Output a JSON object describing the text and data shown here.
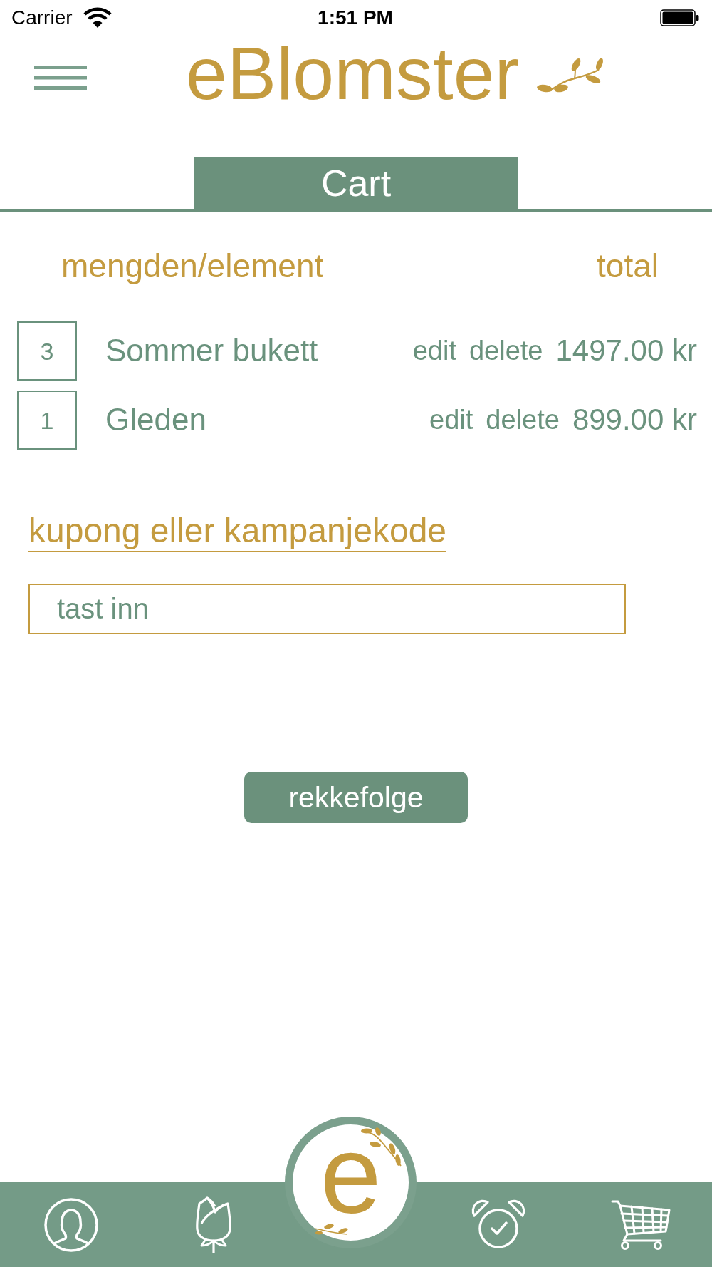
{
  "status_bar": {
    "carrier": "Carrier",
    "time": "1:51 PM"
  },
  "header": {
    "logo": "eBlomster"
  },
  "tabs": [
    {
      "label": "Cart",
      "selected": true
    }
  ],
  "table": {
    "columns": [
      "mengden/element",
      "total"
    ],
    "rows": [
      {
        "quantity": "3",
        "name": "Sommer bukett",
        "edit": "edit",
        "delete": "delete",
        "total": "1497.00 kr"
      },
      {
        "quantity": "1",
        "name": "Gleden",
        "edit": "edit",
        "delete": "delete",
        "total": "899.00 kr"
      }
    ]
  },
  "coupon": {
    "link": "kupong eller kampanjekode",
    "field": {
      "placeholder": "tast inn"
    }
  },
  "order_button": "rekkefolge",
  "tab_bar": {
    "logo": "e"
  }
}
